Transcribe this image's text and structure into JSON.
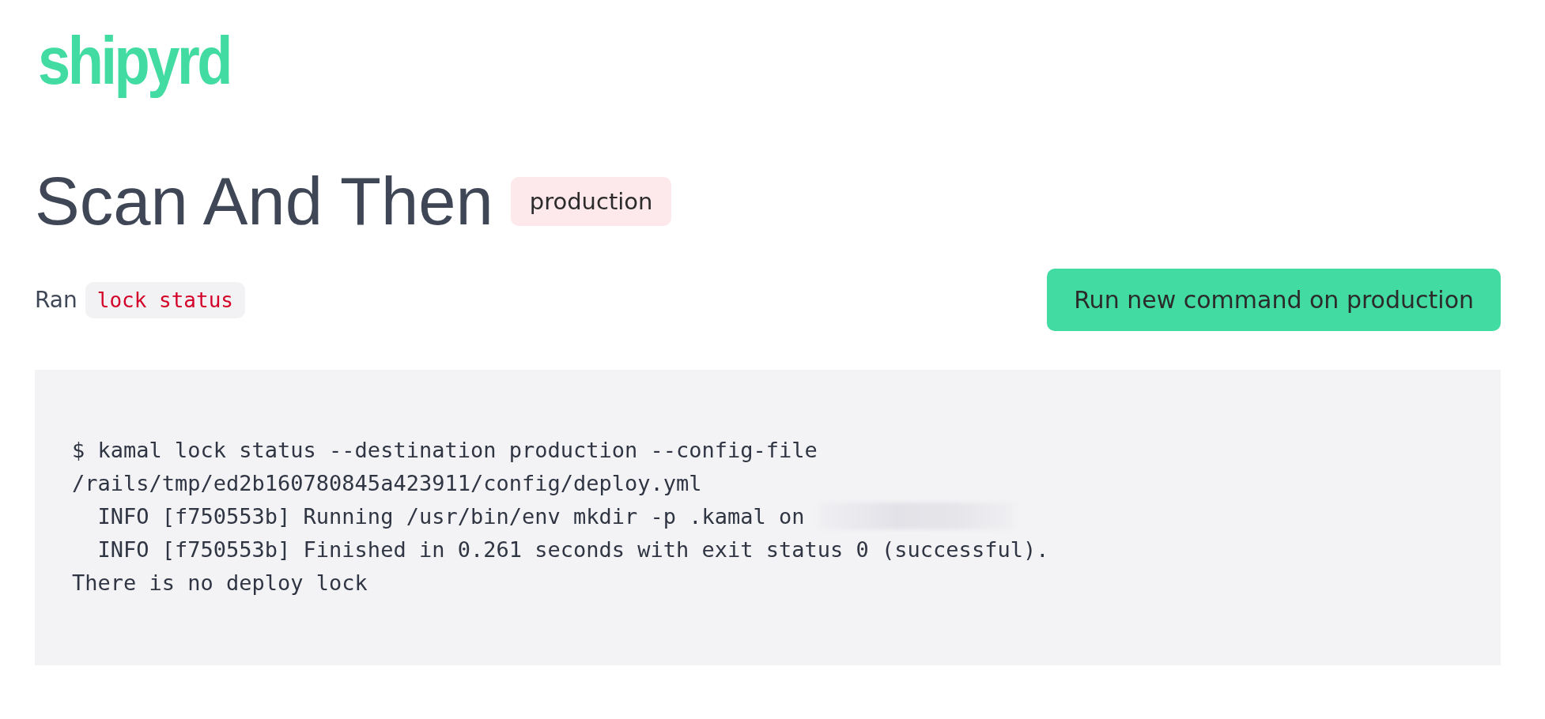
{
  "logo": "shipyrd",
  "title": "Scan And Then",
  "environment_badge": "production",
  "ran": {
    "label": "Ran",
    "command": "lock status"
  },
  "action_button": "Run new command on production",
  "output": {
    "lines": [
      {
        "text": "$ kamal lock status --destination production --config-file",
        "redacted": false
      },
      {
        "text": "/rails/tmp/ed2b160780845a423911/config/deploy.yml",
        "redacted": false
      },
      {
        "text": "  INFO [f750553b] Running /usr/bin/env mkdir -p .kamal on",
        "redacted": true
      },
      {
        "text": "  INFO [f750553b] Finished in 0.261 seconds with exit status 0 (successful).",
        "redacted": false
      },
      {
        "text": "There is no deploy lock",
        "redacted": false
      }
    ]
  }
}
